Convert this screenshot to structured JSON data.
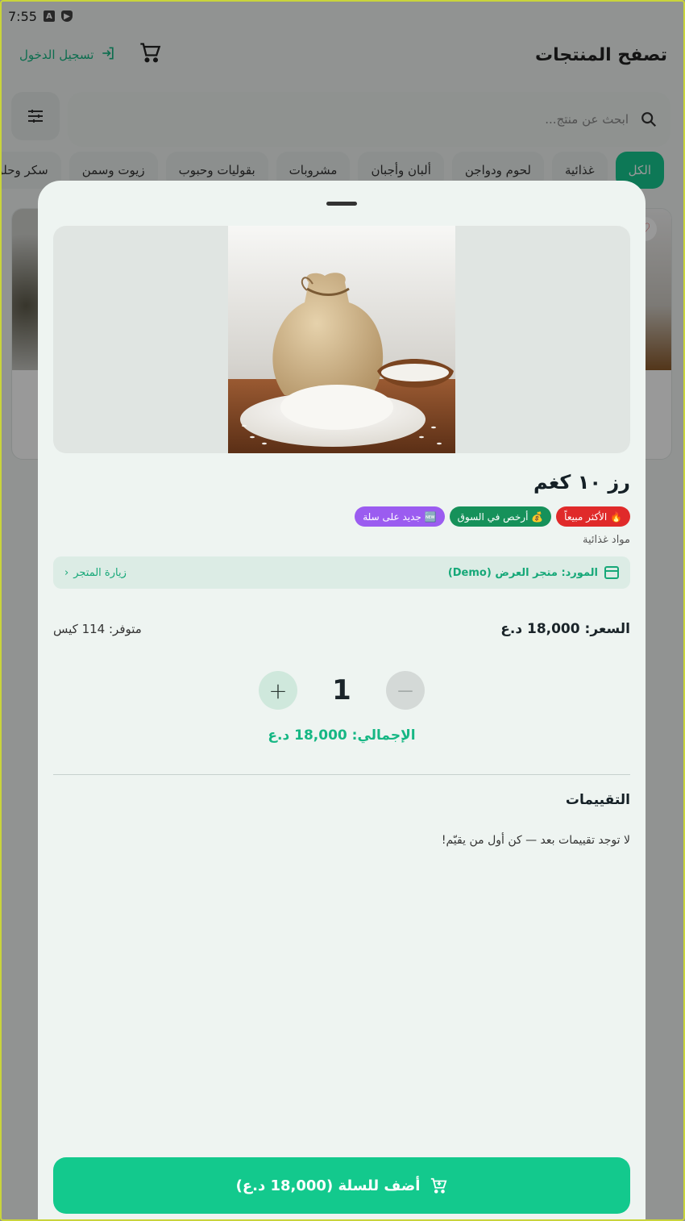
{
  "status_bar": {
    "time": "7:55"
  },
  "header": {
    "title": "تصفح المنتجات",
    "login_label": "تسجيل الدخول",
    "login_icon": "login-icon",
    "cart_icon": "cart-icon"
  },
  "search": {
    "placeholder": "ابحث عن منتج...",
    "icon": "search-icon",
    "filter_icon": "filter-icon"
  },
  "categories": [
    {
      "label": "الكل",
      "active": true
    },
    {
      "label": "غذائية"
    },
    {
      "label": "لحوم ودواجن"
    },
    {
      "label": "ألبان وأجبان"
    },
    {
      "label": "مشروبات"
    },
    {
      "label": "بقوليات وحبوب"
    },
    {
      "label": "زيوت وسمن"
    },
    {
      "label": "سكر وحلو"
    }
  ],
  "product": {
    "title": "رز ١٠ كغم",
    "badges": [
      {
        "label": "🔥 الأكثر مبيعاً",
        "color": "#e02a2a"
      },
      {
        "label": "💰 أرخص في السوق",
        "color": "#16915a"
      },
      {
        "label": "🆕 جديد على سلة",
        "color": "#9b5cf0"
      }
    ],
    "category": "مواد غذائية",
    "supplier": "المورد: متجر العرض (Demo)",
    "visit_store": "زيارة المتجر",
    "price_label": "السعر:",
    "price_value": "18,000 د.ع",
    "stock_label": "متوفر:",
    "stock_value": "114 كيس",
    "quantity": "1",
    "total_label": "الإجمالي:",
    "total_value": "18,000 د.ع"
  },
  "ratings": {
    "title": "التقييمات",
    "empty_text": "لا توجد تقييمات بعد — كن أول من يقيّم!"
  },
  "add_to_cart": {
    "label": "أضف للسلة (18,000 د.ع)"
  },
  "colors": {
    "accent": "#13c98d",
    "sheet_bg": "#eef4f1"
  }
}
